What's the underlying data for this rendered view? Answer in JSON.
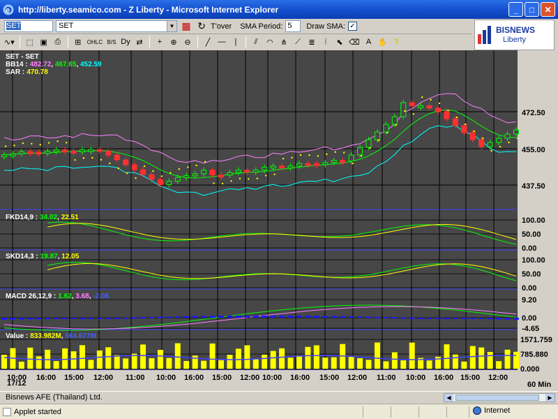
{
  "window": {
    "title": "http://liberty.seamico.com - Z Liberty - Microsoft Internet Explorer"
  },
  "toolbar": {
    "symbol": "SET",
    "combo_value": "SET",
    "tover_label": "T'over",
    "sma_period_label": "SMA Period:",
    "sma_period_value": "5",
    "draw_sma_label": "Draw SMA:",
    "draw_sma_checked": "✓"
  },
  "logo": {
    "line1": "BISNEWS",
    "line2": "Liberty"
  },
  "chart": {
    "title": "SET - SET",
    "bb_label": "BB14 :",
    "bb_values": [
      "482.72",
      "467.65",
      "452.59"
    ],
    "sar_label": "SAR :",
    "sar_value": "470.78",
    "price_ticks": [
      "472.50",
      "455.00",
      "437.50"
    ],
    "fkd_label": "FKD14,9 :",
    "fkd_values": [
      "34.02",
      "22.51"
    ],
    "skd_label": "SKD14,3 :",
    "skd_values": [
      "19.87",
      "12.05"
    ],
    "macd_label": "MACD 26,12,9 :",
    "macd_values": [
      "1.62",
      "3.68",
      "-2.06"
    ],
    "value_label": "Value :",
    "value_values": [
      "833.982M",
      "564.677M"
    ],
    "osc_ticks": [
      "100.00",
      "50.00",
      "0.00"
    ],
    "macd_ticks": [
      "9.20",
      "0.00",
      "-4.65"
    ],
    "value_ticks": [
      "1571.759",
      "785.880",
      "0.000"
    ],
    "time_labels": [
      "10:00",
      "16:00",
      "15:00",
      "12:00",
      "11:00",
      "10:00",
      "16:00",
      "15:00",
      "12:00",
      "10:00",
      "16:00",
      "15:00",
      "12:00",
      "11:00",
      "10:00",
      "16:00",
      "15:00",
      "12:00"
    ],
    "date_label": "17/12",
    "interval_label": "60 Min"
  },
  "colors": {
    "pink": "#ff80ff",
    "green": "#00ff00",
    "cyan": "#00ffff",
    "yellow": "#ffff00",
    "blue": "#4040ff",
    "red": "#ff3030"
  },
  "status": {
    "source": "Bisnews AFE (Thailand) Ltd.",
    "applet": "Applet started",
    "zone": "Internet"
  }
}
